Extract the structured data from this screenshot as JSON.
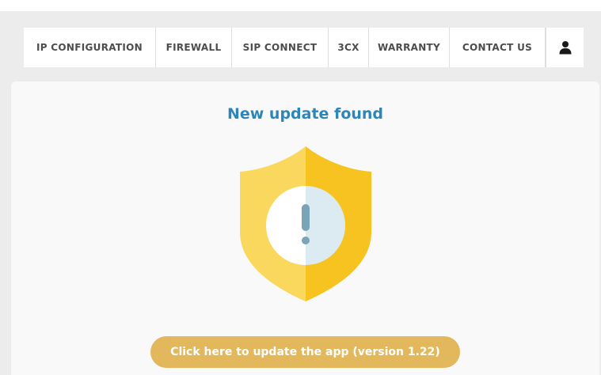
{
  "nav": {
    "items": [
      {
        "label": "IP CONFIGURATION"
      },
      {
        "label": "FIREWALL"
      },
      {
        "label": "SIP CONNECT"
      },
      {
        "label": "3CX"
      },
      {
        "label": "WARRANTY"
      },
      {
        "label": "CONTACT US"
      }
    ],
    "user_icon": "user-icon"
  },
  "main": {
    "title": "New update found",
    "shield_icon": "shield-alert-icon",
    "update_button": "Click here to update the app (version 1.22)"
  },
  "colors": {
    "title": "#2d86b9",
    "shield_left": "#fad85e",
    "shield_right": "#f7c320",
    "button": "#e3b85c",
    "exclamation": "#7aa5b8"
  }
}
